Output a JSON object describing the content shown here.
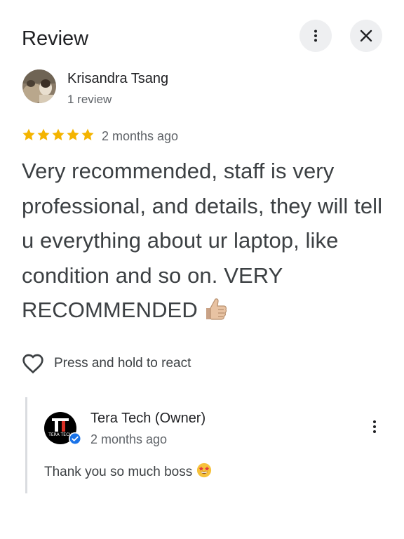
{
  "header": {
    "title": "Review",
    "more_icon": "more-vert-icon",
    "close_icon": "close-icon"
  },
  "review": {
    "author_name": "Krisandra Tsang",
    "author_meta": "1 review",
    "rating": 5,
    "rating_max": 5,
    "date": "2 months ago",
    "text": "Very recommended, staff is very professional, and details, they will tell u everything about ur laptop, like condition and so on. VERY RECOMMENDED",
    "text_emoji": "thumbs-up-icon"
  },
  "react": {
    "label": "Press and hold to react",
    "icon": "heart-outline-icon"
  },
  "owner_reply": {
    "name": "Tera Tech (Owner)",
    "date": "2 months ago",
    "avatar_text": "TERA TECH",
    "verified_icon": "verified-check-icon",
    "text": "Thank you so much boss",
    "text_emoji": "star-struck-emoji-icon"
  },
  "colors": {
    "star": "#f4b400",
    "text_primary": "#202124",
    "text_secondary": "#5f6368",
    "button_bg": "#eeeff1",
    "verified": "#1a73e8",
    "owner_logo_accent": "#d93025"
  }
}
